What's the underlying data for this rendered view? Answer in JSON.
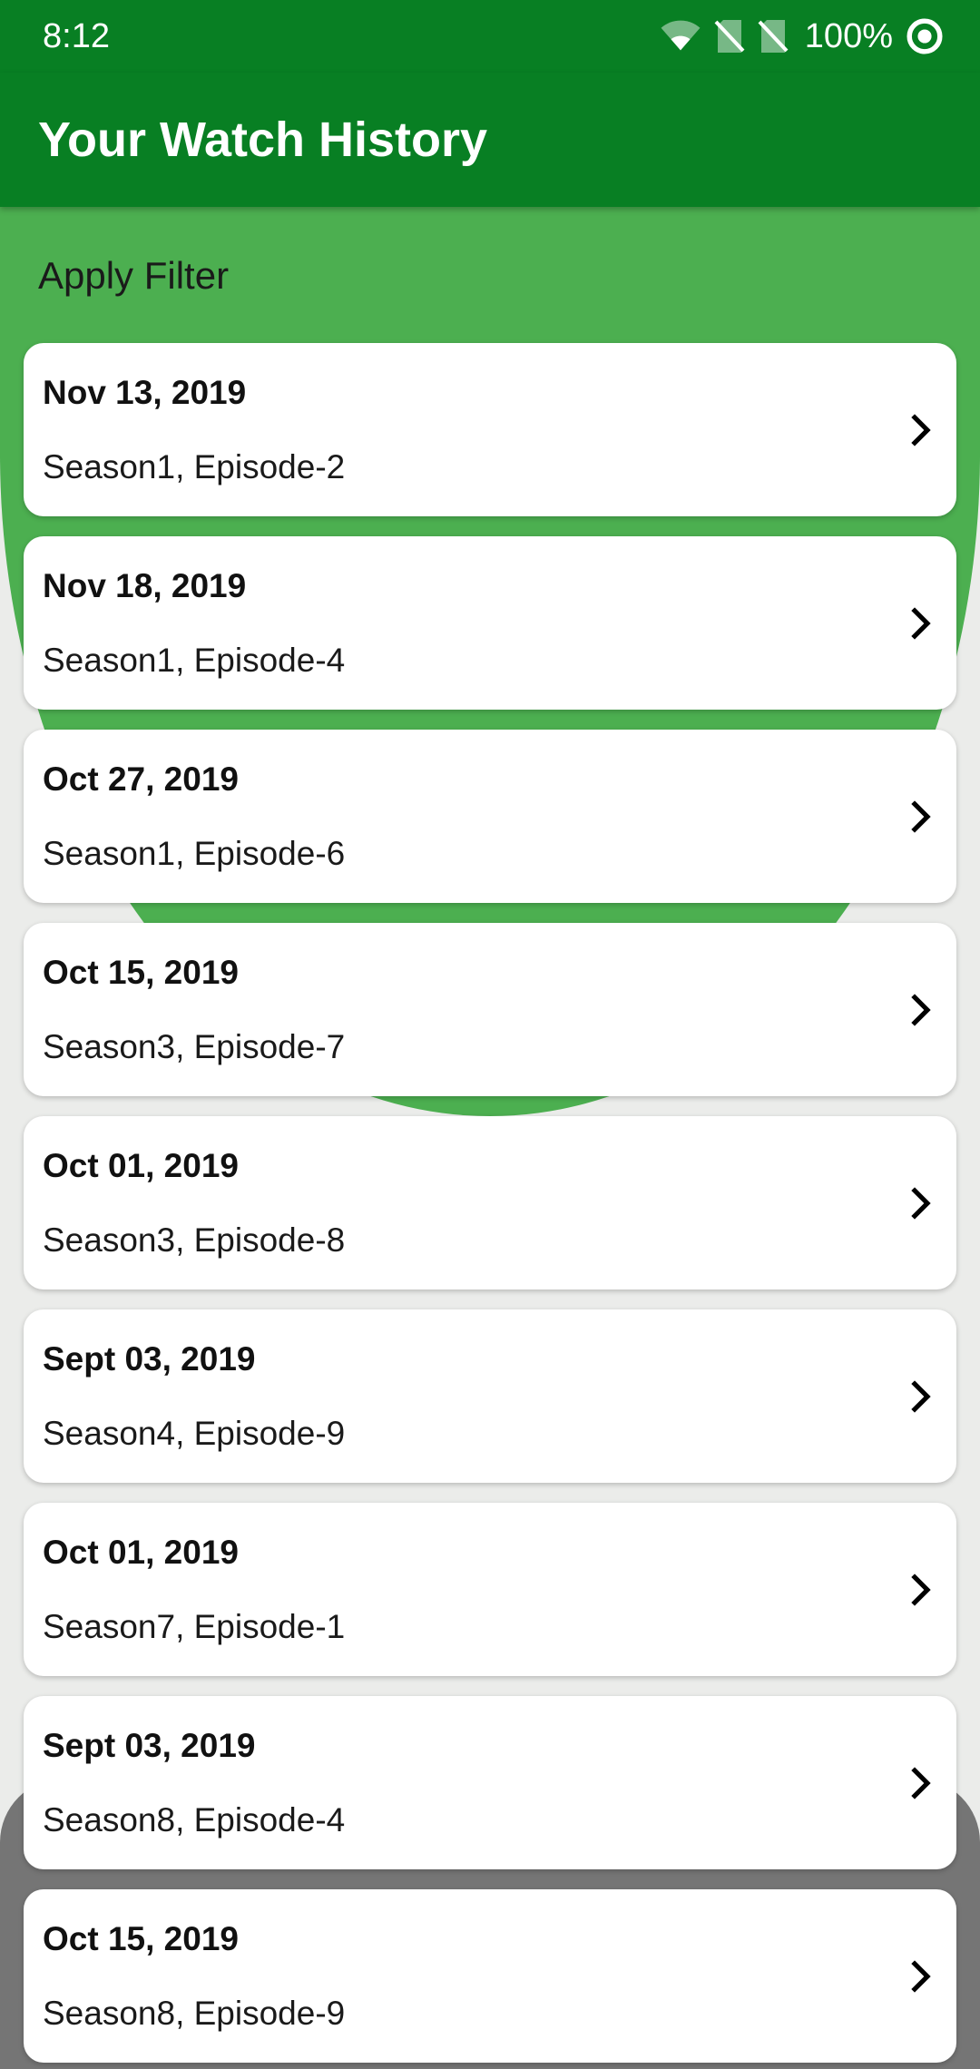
{
  "status_bar": {
    "time": "8:12",
    "battery": "100%",
    "icons": [
      "wifi-icon",
      "no-sim-icon",
      "no-sim-icon",
      "status-circle-icon"
    ]
  },
  "app_bar": {
    "title": "Your Watch History"
  },
  "filter": {
    "label": "Apply Filter"
  },
  "history": [
    {
      "date": "Nov 13, 2019",
      "episode": "Season1, Episode-2"
    },
    {
      "date": "Nov 18, 2019",
      "episode": "Season1, Episode-4"
    },
    {
      "date": "Oct 27, 2019",
      "episode": "Season1, Episode-6"
    },
    {
      "date": "Oct 15, 2019",
      "episode": "Season3, Episode-7"
    },
    {
      "date": "Oct 01, 2019",
      "episode": "Season3, Episode-8"
    },
    {
      "date": "Sept 03, 2019",
      "episode": "Season4, Episode-9"
    },
    {
      "date": "Oct 01, 2019",
      "episode": "Season7, Episode-1"
    },
    {
      "date": "Sept 03, 2019",
      "episode": "Season8, Episode-4"
    },
    {
      "date": "Oct 15, 2019",
      "episode": "Season8, Episode-9"
    }
  ],
  "colors": {
    "primary_dark": "#087f23",
    "accent_green": "#4caf50",
    "background": "#ebecea",
    "bottom_sheet_gray": "#757575",
    "card": "#ffffff"
  }
}
